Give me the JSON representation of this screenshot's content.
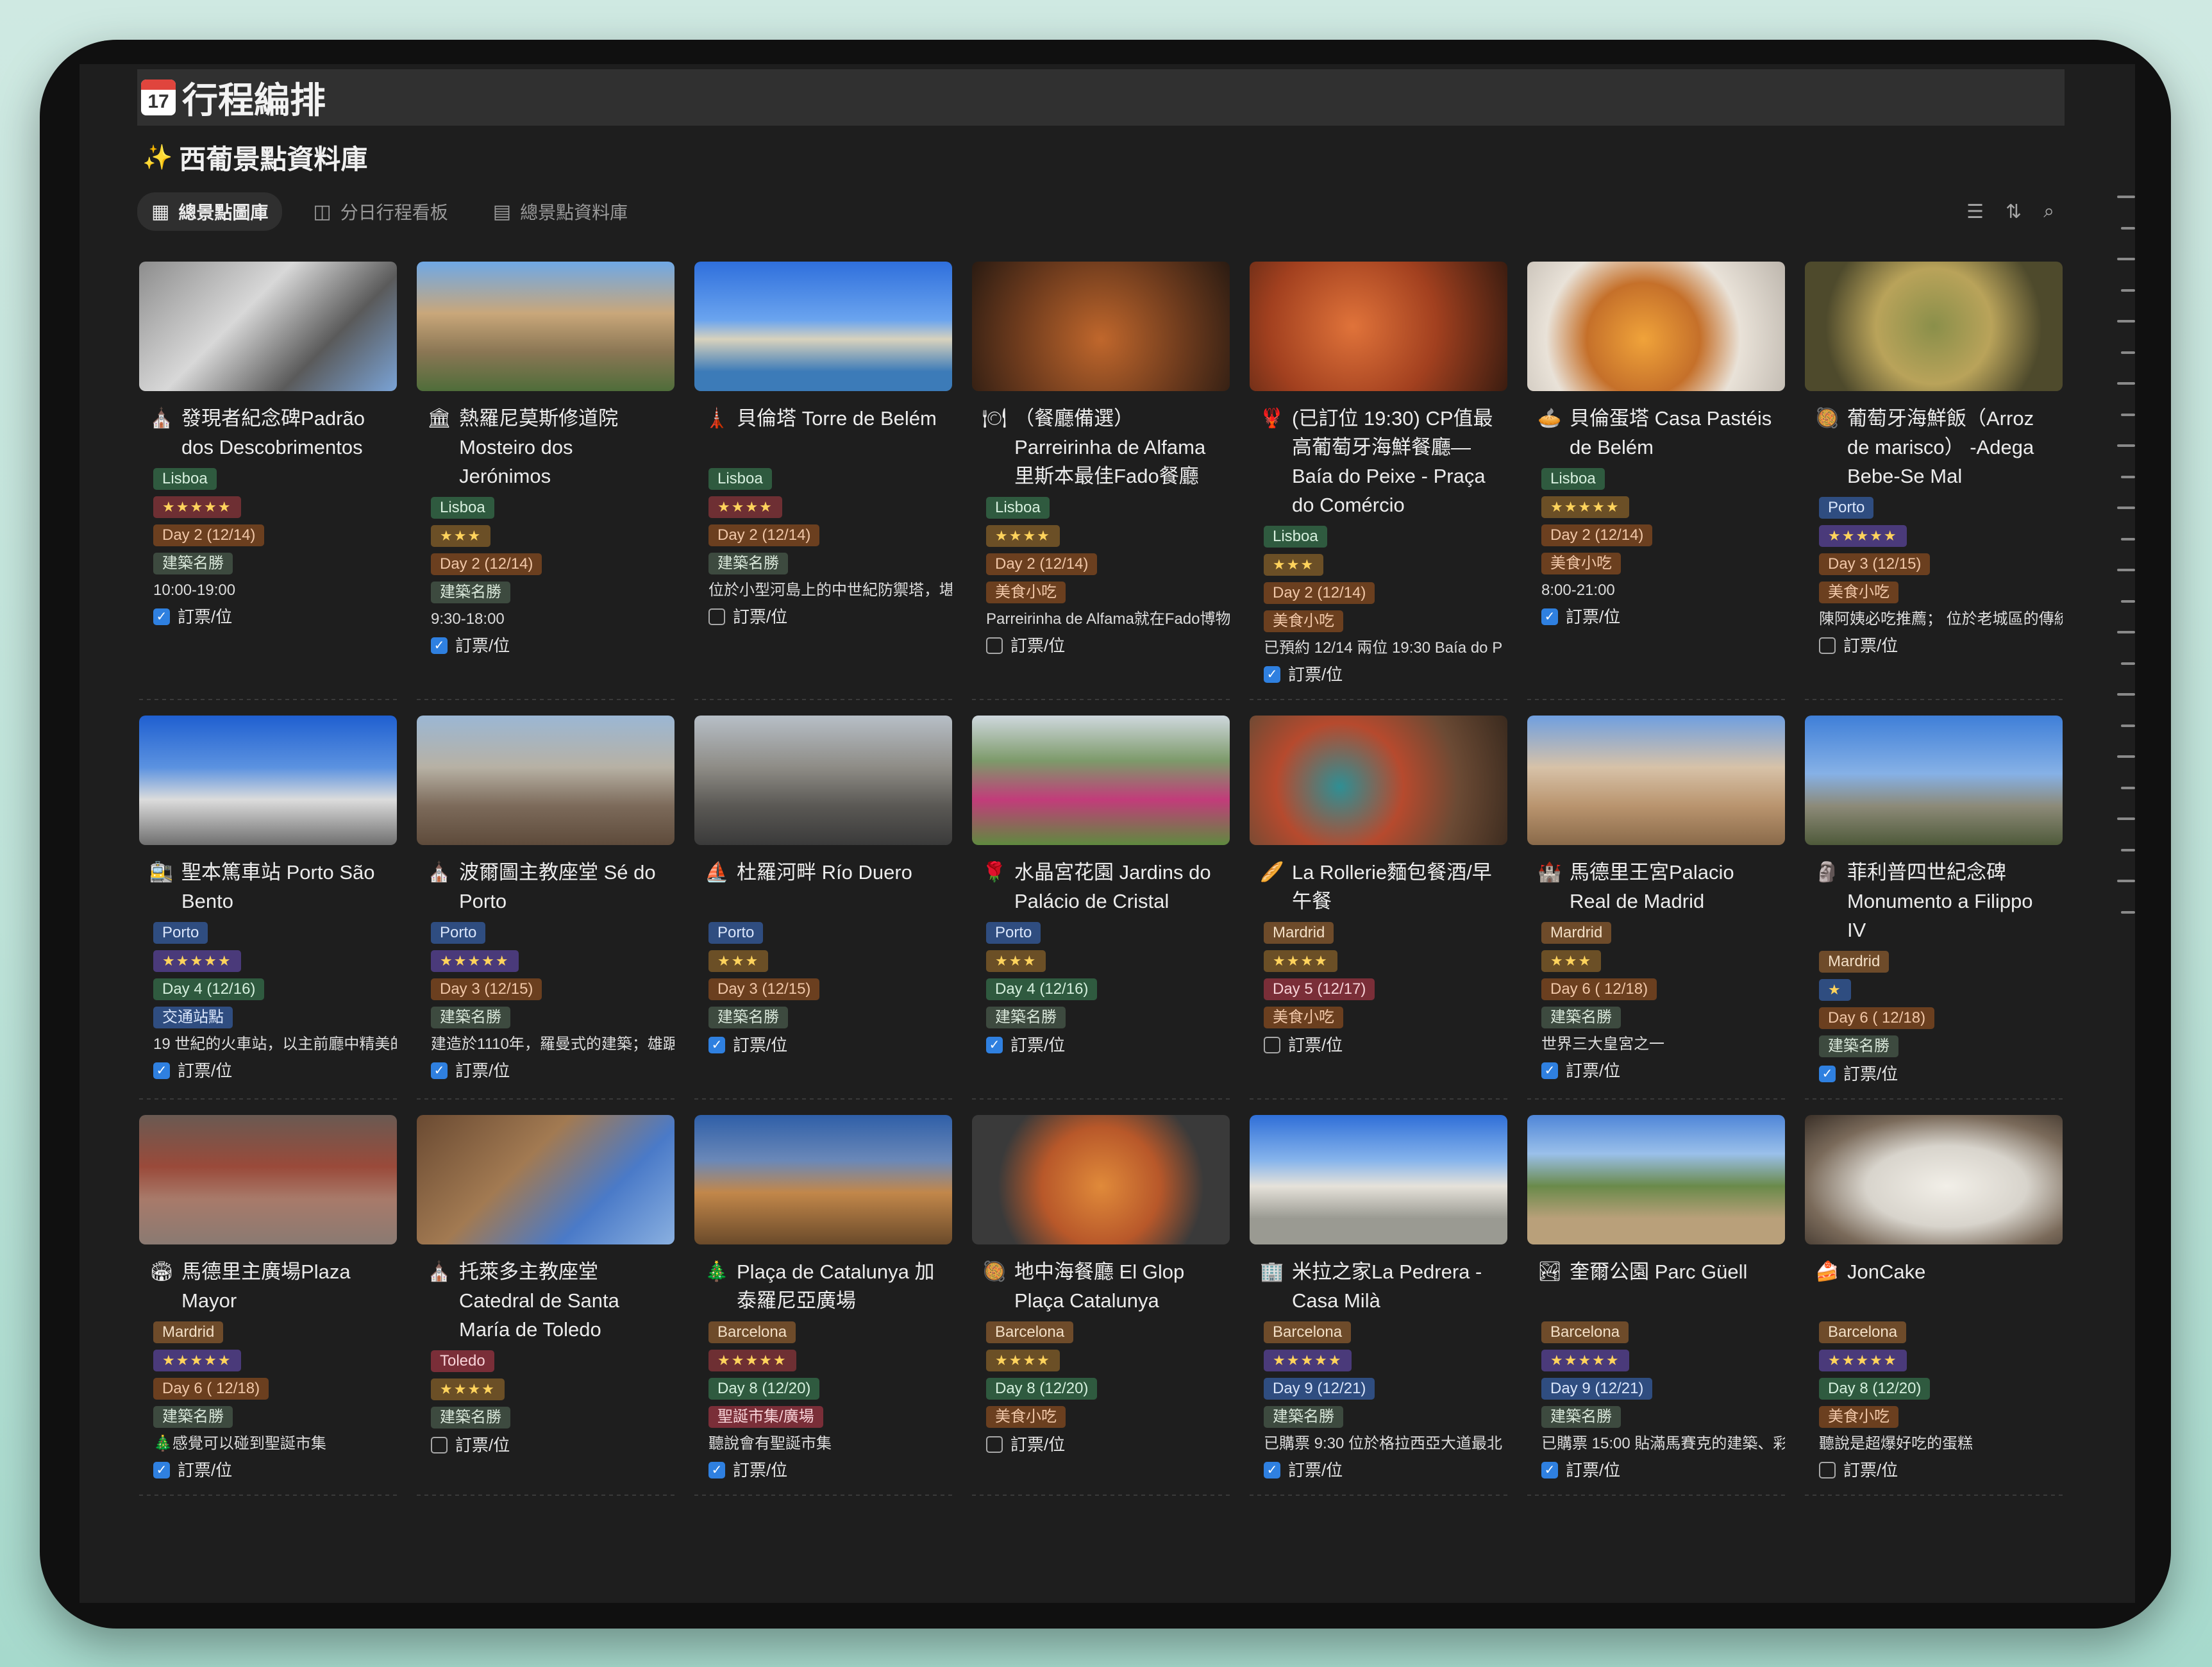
{
  "page": {
    "title": "行程編排",
    "calendar_icon_day": "17"
  },
  "database": {
    "title": "西葡景點資料庫",
    "icon": "sparkles-icon"
  },
  "tabs": [
    {
      "label": "總景點圖庫",
      "icon": "gallery-icon",
      "active": true
    },
    {
      "label": "分日行程看板",
      "icon": "board-icon",
      "active": false
    },
    {
      "label": "總景點資料庫",
      "icon": "table-icon",
      "active": false
    }
  ],
  "toolbar": {
    "icons": [
      "filter-icon",
      "sort-icon",
      "search-icon"
    ]
  },
  "cards": [
    {
      "icon": "⛪",
      "title": "發現者紀念碑Padrão dos Descobrimentos",
      "city": "Lisboa",
      "stars": "★★★★★",
      "day": "Day 2 (12/14)",
      "category": "建築名勝",
      "note": "10:00-19:00",
      "booked": true
    },
    {
      "icon": "🏛",
      "title": "熱羅尼莫斯修道院 Mosteiro dos Jerónimos",
      "city": "Lisboa",
      "stars": "★★★",
      "day": "Day 2 (12/14)",
      "category": "建築名勝",
      "note": "9:30-18:00",
      "booked": true
    },
    {
      "icon": "🗼",
      "title": "貝倫塔 Torre de Belém",
      "city": "Lisboa",
      "stars": "★★★★",
      "day": "Day 2 (12/14)",
      "category": "建築名勝",
      "note": "位於小型河島上的中世紀防禦塔，堪",
      "booked": false
    },
    {
      "icon": "🍽",
      "title": "（餐廳備選） Parreirinha de Alfama 里斯本最佳Fado餐廳",
      "city": "Lisboa",
      "stars": "★★★★",
      "day": "Day 2 (12/14)",
      "category": "美食小吃",
      "note": "Parreirinha de Alfama就在Fado博物",
      "booked": false
    },
    {
      "icon": "🦞",
      "title": "(已訂位 19:30) CP值最高葡萄牙海鮮餐廳— Baía do Peixe - Praça do Comércio",
      "city": "Lisboa",
      "stars": "★★★",
      "day": "Day 2 (12/14)",
      "category": "美食小吃",
      "note": "已預約 12/14 兩位 19:30 Baía do P",
      "booked": true
    },
    {
      "icon": "🥧",
      "title": "貝倫蛋塔 Casa Pastéis de Belém",
      "city": "Lisboa",
      "stars": "★★★★★",
      "day": "Day 2 (12/14)",
      "category": "美食小吃",
      "note": "8:00-21:00",
      "booked": true
    },
    {
      "icon": "🥘",
      "title": "葡萄牙海鮮飯（Arroz de marisco） -Adega Bebe-Se Mal",
      "city": "Porto",
      "stars": "★★★★★",
      "day": "Day 3 (12/15)",
      "category": "美食小吃",
      "note": "陳阿姨必吃推薦； 位於老城區的傳統",
      "booked": false
    },
    {
      "icon": "🚉",
      "title": "聖本篤車站 Porto São Bento",
      "city": "Porto",
      "stars": "★★★★★",
      "day": "Day 4 (12/16)",
      "category": "交通站點",
      "note": "19 世紀的火車站，以主前廳中精美的",
      "booked": true
    },
    {
      "icon": "⛪",
      "title": "波爾圖主教座堂 Sé do Porto",
      "city": "Porto",
      "stars": "★★★★★",
      "day": "Day 3 (12/15)",
      "category": "建築名勝",
      "note": "建造於1110年，羅曼式的建築；雄踞",
      "booked": true
    },
    {
      "icon": "⛵",
      "title": "杜羅河畔 Río Duero",
      "city": "Porto",
      "stars": "★★★",
      "day": "Day 3 (12/15)",
      "category": "建築名勝",
      "note": "",
      "booked": true
    },
    {
      "icon": "🌹",
      "title": "水晶宮花園 Jardins do Palácio de Cristal",
      "city": "Porto",
      "stars": "★★★",
      "day": "Day 4 (12/16)",
      "category": "建築名勝",
      "note": "",
      "booked": true
    },
    {
      "icon": "🥖",
      "title": "La Rollerie麵包餐酒/早午餐",
      "city": "Mardrid",
      "stars": "★★★★",
      "day": "Day 5 (12/17)",
      "category": "美食小吃",
      "note": "",
      "booked": false
    },
    {
      "icon": "🏰",
      "title": "馬德里王宮Palacio Real de Madrid",
      "city": "Mardrid",
      "stars": "★★★",
      "day": "Day 6 ( 12/18)",
      "category": "建築名勝",
      "note": "世界三大皇宮之一",
      "booked": true
    },
    {
      "icon": "🗿",
      "title": "菲利普四世紀念碑 Monumento a Filippo IV",
      "city": "Mardrid",
      "stars": "★",
      "day": "Day 6 ( 12/18)",
      "category": "建築名勝",
      "note": "",
      "booked": true
    },
    {
      "icon": "🏟",
      "title": "馬德里主廣場Plaza Mayor",
      "city": "Mardrid",
      "stars": "★★★★★",
      "day": "Day 6 ( 12/18)",
      "category": "建築名勝",
      "note": "🎄感覺可以碰到聖誕市集",
      "booked": true
    },
    {
      "icon": "⛪",
      "title": "托萊多主教座堂 Catedral de Santa María de Toledo",
      "city": "Toledo",
      "stars": "★★★★",
      "day": "",
      "category": "建築名勝",
      "note": "",
      "booked": false
    },
    {
      "icon": "🎄",
      "title": "Plaça de Catalunya 加泰羅尼亞廣場",
      "city": "Barcelona",
      "stars": "★★★★★",
      "day": "Day 8 (12/20)",
      "category": "聖誕市集/廣場",
      "note": "聽說會有聖誕市集",
      "booked": true
    },
    {
      "icon": "🥘",
      "title": "地中海餐廳 El Glop Plaça Catalunya",
      "city": "Barcelona",
      "stars": "★★★★",
      "day": "Day 8 (12/20)",
      "category": "美食小吃",
      "note": "",
      "booked": false
    },
    {
      "icon": "🏢",
      "title": "米拉之家La Pedrera - Casa Milà",
      "city": "Barcelona",
      "stars": "★★★★★",
      "day": "Day 9 (12/21)",
      "category": "建築名勝",
      "note": "已購票 9:30 位於格拉西亞大道最北",
      "booked": true
    },
    {
      "icon": "🏞",
      "title": "奎爾公園 Parc Güell",
      "city": "Barcelona",
      "stars": "★★★★★",
      "day": "Day 9 (12/21)",
      "category": "建築名勝",
      "note": "已購票 15:00 貼滿馬賽克的建築、彩",
      "booked": true
    },
    {
      "icon": "🍰",
      "title": "JonCake",
      "city": "Barcelona",
      "stars": "★★★★★",
      "day": "Day 8 (12/20)",
      "category": "美食小吃",
      "note": "聽說是超爆好吃的蛋糕",
      "booked": false
    }
  ],
  "booked_label": "訂票/位"
}
